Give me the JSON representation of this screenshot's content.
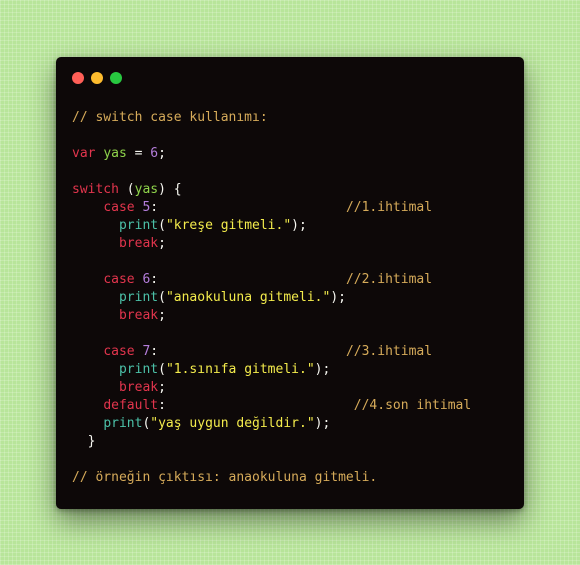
{
  "window": {
    "dots": [
      {
        "name": "close",
        "color": "#ff5f57"
      },
      {
        "name": "minimize",
        "color": "#febc2e"
      },
      {
        "name": "maximize",
        "color": "#28c840"
      }
    ]
  },
  "colors": {
    "background": "#b8e59a",
    "editor_background": "#0d0808",
    "comment": "#d6ab5a",
    "keyword": "#e2354d",
    "variable": "#8fd44b",
    "number": "#b57edc",
    "function": "#4cc1a8",
    "string": "#f4ec4c",
    "plain": "#f8f8f2"
  },
  "code": {
    "lines": [
      [
        [
          "cm",
          "// switch case kullanımı:"
        ]
      ],
      [],
      [
        [
          "kw",
          "var"
        ],
        [
          "pl",
          " "
        ],
        [
          "vr",
          "yas"
        ],
        [
          "pl",
          " = "
        ],
        [
          "nm",
          "6"
        ],
        [
          "pl",
          ";"
        ]
      ],
      [],
      [
        [
          "kw",
          "switch"
        ],
        [
          "pl",
          " ("
        ],
        [
          "vr",
          "yas"
        ],
        [
          "pl",
          ") {"
        ]
      ],
      [
        [
          "pl",
          "    "
        ],
        [
          "kw",
          "case"
        ],
        [
          "pl",
          " "
        ],
        [
          "nm",
          "5"
        ],
        [
          "pl",
          ":                        "
        ],
        [
          "cm",
          "//1.ihtimal"
        ]
      ],
      [
        [
          "pl",
          "      "
        ],
        [
          "fn",
          "print"
        ],
        [
          "pl",
          "("
        ],
        [
          "st",
          "\"kreşe gitmeli.\""
        ],
        [
          "pl",
          ");"
        ]
      ],
      [
        [
          "pl",
          "      "
        ],
        [
          "kw",
          "break"
        ],
        [
          "pl",
          ";"
        ]
      ],
      [],
      [
        [
          "pl",
          "    "
        ],
        [
          "kw",
          "case"
        ],
        [
          "pl",
          " "
        ],
        [
          "nm",
          "6"
        ],
        [
          "pl",
          ":                        "
        ],
        [
          "cm",
          "//2.ihtimal"
        ]
      ],
      [
        [
          "pl",
          "      "
        ],
        [
          "fn",
          "print"
        ],
        [
          "pl",
          "("
        ],
        [
          "st",
          "\"anaokuluna gitmeli.\""
        ],
        [
          "pl",
          ");"
        ]
      ],
      [
        [
          "pl",
          "      "
        ],
        [
          "kw",
          "break"
        ],
        [
          "pl",
          ";"
        ]
      ],
      [],
      [
        [
          "pl",
          "    "
        ],
        [
          "kw",
          "case"
        ],
        [
          "pl",
          " "
        ],
        [
          "nm",
          "7"
        ],
        [
          "pl",
          ":                        "
        ],
        [
          "cm",
          "//3.ihtimal"
        ]
      ],
      [
        [
          "pl",
          "      "
        ],
        [
          "fn",
          "print"
        ],
        [
          "pl",
          "("
        ],
        [
          "st",
          "\"1.sınıfa gitmeli.\""
        ],
        [
          "pl",
          ");"
        ]
      ],
      [
        [
          "pl",
          "      "
        ],
        [
          "kw",
          "break"
        ],
        [
          "pl",
          ";"
        ]
      ],
      [
        [
          "pl",
          "    "
        ],
        [
          "kw",
          "default"
        ],
        [
          "pl",
          ":                        "
        ],
        [
          "cm",
          "//4.son ihtimal"
        ]
      ],
      [
        [
          "pl",
          "    "
        ],
        [
          "fn",
          "print"
        ],
        [
          "pl",
          "("
        ],
        [
          "st",
          "\"yaş uygun değildir.\""
        ],
        [
          "pl",
          ");"
        ]
      ],
      [
        [
          "pl",
          "  }"
        ]
      ],
      [],
      [
        [
          "cm",
          "// örneğin çıktısı: anaokuluna gitmeli."
        ]
      ]
    ]
  }
}
